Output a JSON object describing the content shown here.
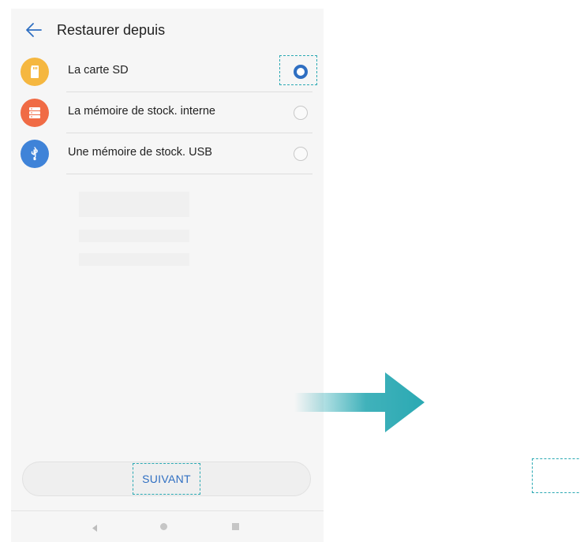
{
  "header": {
    "title": "Restaurer depuis",
    "back_icon": "arrow-left-icon"
  },
  "options": [
    {
      "label": "La carte SD",
      "icon": "sd-card-icon",
      "color": "#f5b740",
      "selected": true
    },
    {
      "label": "La mémoire de stock. interne",
      "icon": "internal-storage-icon",
      "color": "#f06b45",
      "selected": false
    },
    {
      "label": "Une mémoire de stock. USB",
      "icon": "usb-icon",
      "color": "#3f83d8",
      "selected": false
    }
  ],
  "button": {
    "label": "SUIVANT"
  },
  "navbar": {
    "icons": [
      "nav-back-icon",
      "nav-home-icon",
      "nav-recent-icon"
    ]
  },
  "colors": {
    "accent": "#2f6fc2",
    "highlight": "#2ba9b3"
  }
}
